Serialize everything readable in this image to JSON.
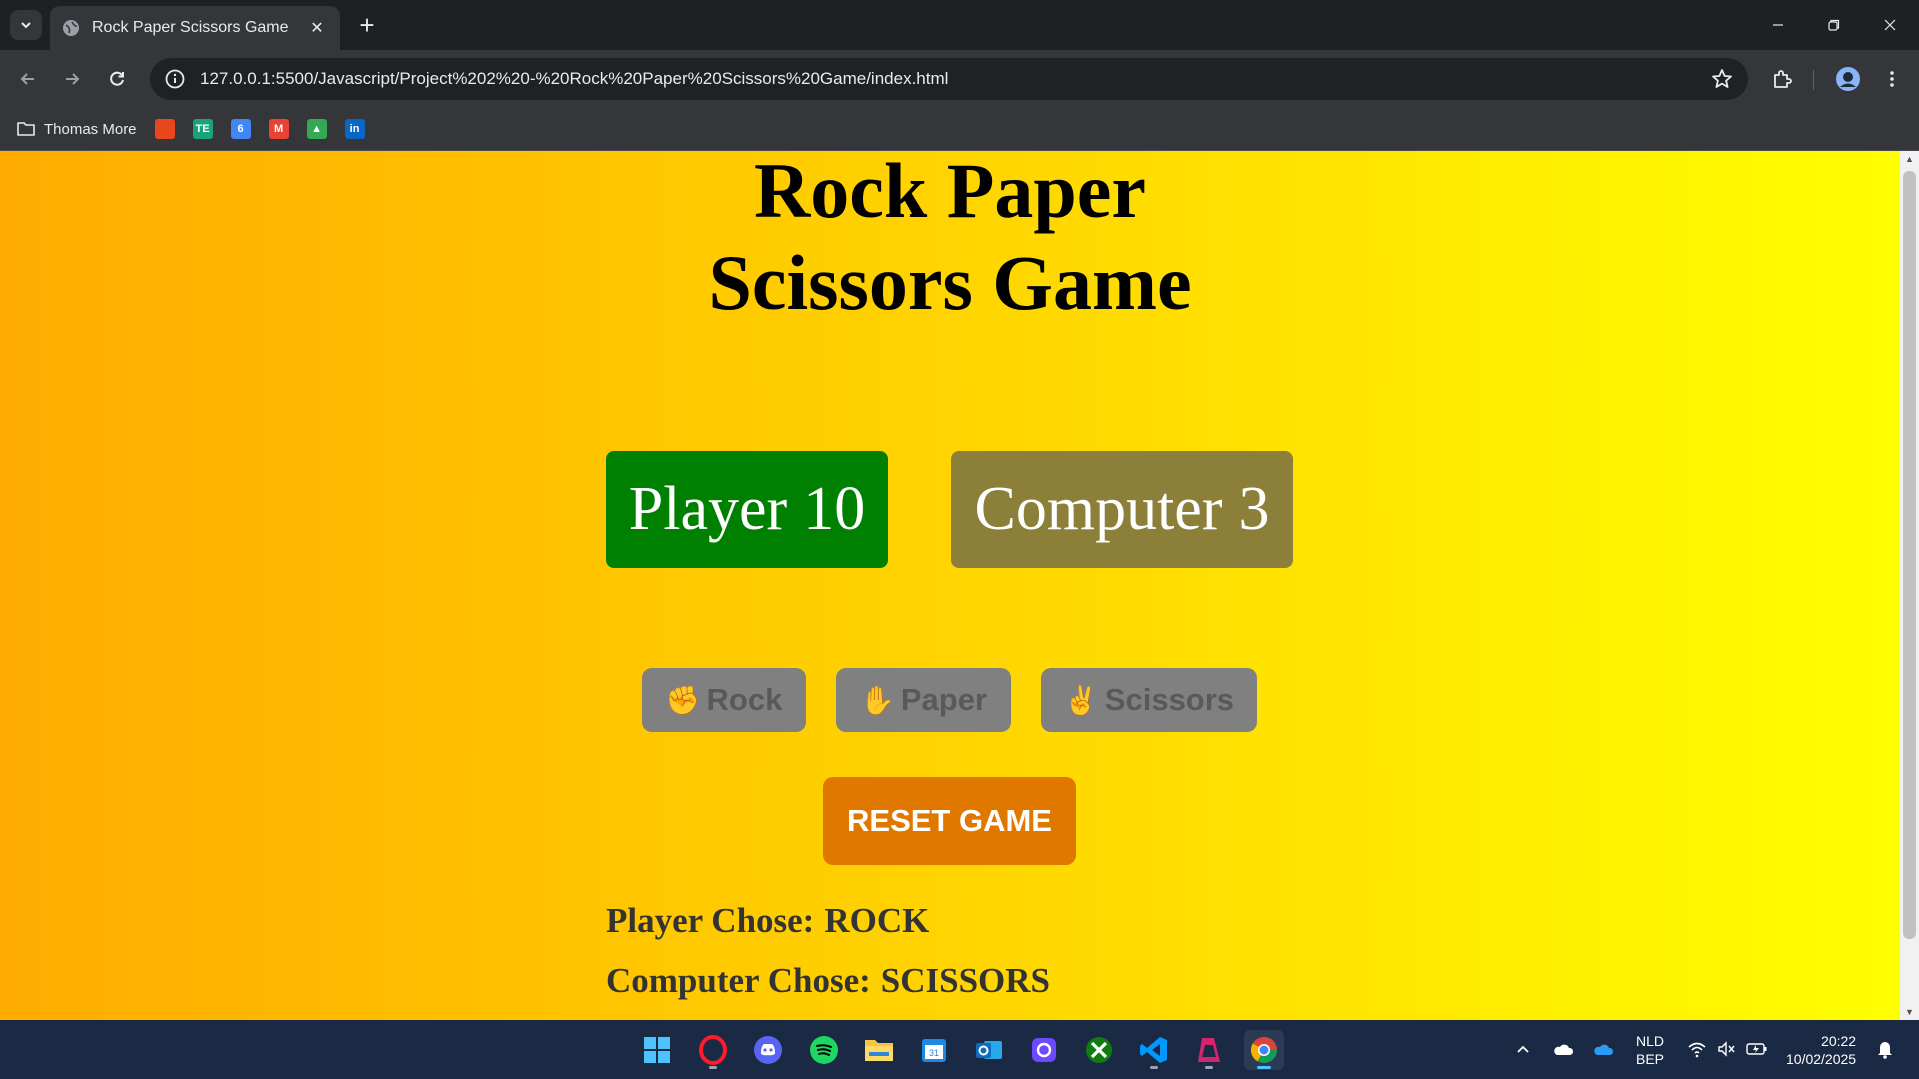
{
  "browser": {
    "tab_title": "Rock Paper Scissors Game",
    "tab_close": "✕",
    "new_tab": "+",
    "url": "127.0.0.1:5500/Javascript/Project%202%20-%20Rock%20Paper%20Scissors%20Game/index.html",
    "bookmarks": {
      "folder_label": "Thomas More",
      "items": [
        {
          "icon": "red-square-icon",
          "color": "#e8471c",
          "text": ""
        },
        {
          "icon": "te-icon",
          "color": "#1aa37a",
          "text": "TE"
        },
        {
          "icon": "calendar-icon",
          "color": "#4285f4",
          "text": "6"
        },
        {
          "icon": "gmail-icon",
          "color": "#ea4335",
          "text": "M"
        },
        {
          "icon": "drive-icon",
          "color": "#34a853",
          "text": "▲"
        },
        {
          "icon": "linkedin-icon",
          "color": "#0a66c2",
          "text": "in"
        }
      ]
    }
  },
  "page": {
    "title": "Rock Paper Scissors Game",
    "player_score_label": "Player",
    "player_score_value": "10",
    "computer_score_label": "Computer",
    "computer_score_value": "3",
    "choices": {
      "rock": {
        "emoji": "✊",
        "label": "Rock"
      },
      "paper": {
        "emoji": "✋",
        "label": "Paper"
      },
      "scissors": {
        "emoji": "✌",
        "label": "Scissors"
      }
    },
    "reset_label": "RESET GAME",
    "player_chose_label": "Player Chose:",
    "player_chose_value": "ROCK",
    "computer_chose_label": "Computer Chose:",
    "computer_chose_value": "SCISSORS"
  },
  "colors": {
    "player_score_bg": "#008000",
    "computer_score_bg": "#8b7f3a",
    "choice_bg": "#808080",
    "reset_bg": "#e07800"
  },
  "taskbar": {
    "apps": [
      "windows-start-icon",
      "opera-icon",
      "discord-icon",
      "spotify-icon",
      "file-explorer-icon",
      "calendar-app-icon",
      "outlook-icon",
      "proton-icon",
      "xbox-icon",
      "vscode-icon",
      "affinity-icon",
      "chrome-icon"
    ],
    "language_top": "NLD",
    "language_bottom": "BEP",
    "time": "20:22",
    "date": "10/02/2025"
  }
}
